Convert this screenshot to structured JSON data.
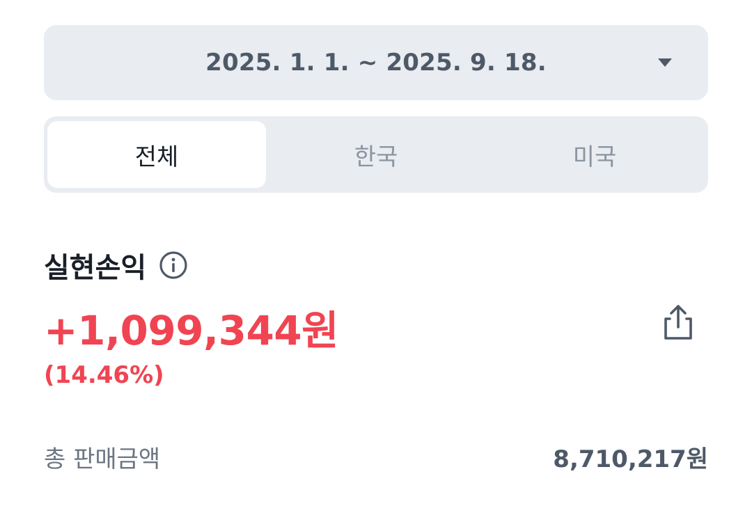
{
  "date_selector": {
    "range": "2025. 1. 1. ~ 2025. 9. 18."
  },
  "segment": {
    "tabs": [
      {
        "label": "전체",
        "selected": true
      },
      {
        "label": "한국",
        "selected": false
      },
      {
        "label": "미국",
        "selected": false
      }
    ]
  },
  "summary": {
    "title": "실현손익",
    "amount": "+1,099,344원",
    "rate": "(14.46%)"
  },
  "details": {
    "total_sales_label": "총 판매금액",
    "total_sales_value": "8,710,217원"
  },
  "colors": {
    "profit_red": "#f04452",
    "panel_bg": "#e9ecf0",
    "muted_text": "#8b95a1"
  },
  "icons": {
    "dropdown": "caret-down-icon",
    "info": "info-icon",
    "share": "share-icon"
  }
}
